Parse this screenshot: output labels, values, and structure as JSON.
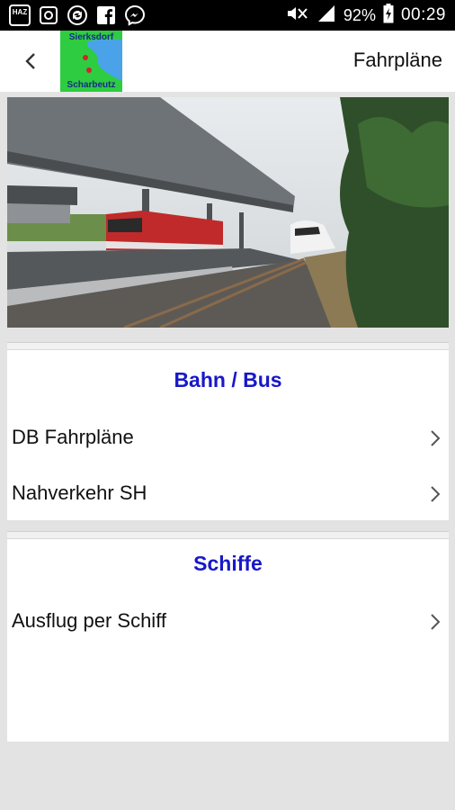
{
  "status_bar": {
    "battery": "92%",
    "time": "00:29",
    "app_icons": [
      "haz-app-icon",
      "photo-icon",
      "sync-icon",
      "facebook-icon",
      "messenger-icon"
    ],
    "haz_label": "HAZ"
  },
  "app_bar": {
    "title": "Fahrpläne",
    "logo_top": "Sierksdorf",
    "logo_bottom": "Scharbeutz"
  },
  "sections": [
    {
      "title": "Bahn / Bus",
      "items": [
        {
          "label": "DB Fahrpläne"
        },
        {
          "label": "Nahverkehr SH"
        }
      ]
    },
    {
      "title": "Schiffe",
      "items": [
        {
          "label": "Ausflug per Schiff"
        }
      ]
    }
  ],
  "colors": {
    "section_title": "#1818c8",
    "logo_bg": "#2ecc40",
    "background": "#e3e3e3"
  }
}
